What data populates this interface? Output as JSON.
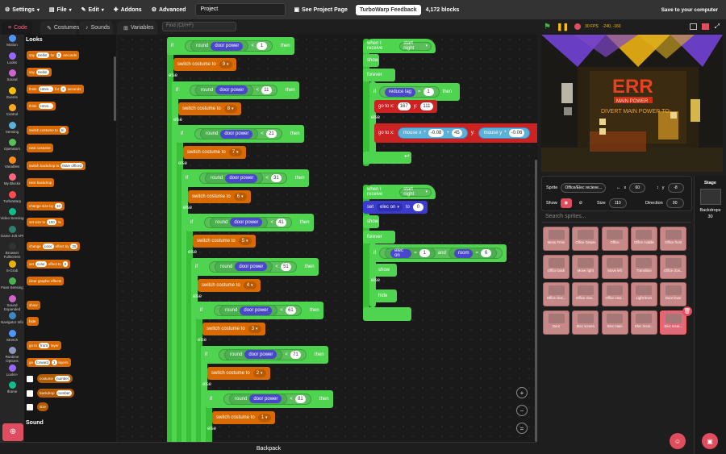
{
  "menu": {
    "settings": "Settings",
    "file": "File",
    "edit": "Edit",
    "addons": "Addons",
    "advanced": "Advanced",
    "project_title": "Project",
    "see_project_page": "See Project Page",
    "feedback": "TurboWarp Feedback",
    "block_count": "4,172 blocks",
    "save": "Save to your computer"
  },
  "tabs": {
    "code": "Code",
    "costumes": "Costumes",
    "sounds": "Sounds",
    "variables": "Variables"
  },
  "find_placeholder": "Find (Ctrl+F)",
  "categories": [
    {
      "label": "Motion",
      "color": "#4c97ff"
    },
    {
      "label": "Looks",
      "color": "#9966ff"
    },
    {
      "label": "Sound",
      "color": "#cf63cf"
    },
    {
      "label": "Events",
      "color": "#ffbf00"
    },
    {
      "label": "Control",
      "color": "#ffab19"
    },
    {
      "label": "Sensing",
      "color": "#5cb1d6"
    },
    {
      "label": "Operators",
      "color": "#59c059"
    },
    {
      "label": "Variables",
      "color": "#ff8c1a"
    },
    {
      "label": "My Blocks",
      "color": "#ff6680"
    },
    {
      "label": "TurboWarp",
      "color": "#ff4c4c"
    },
    {
      "label": "Video Sensing",
      "color": "#0fbd8c"
    },
    {
      "label": "Game Jolt API",
      "color": "#2f7f6f"
    },
    {
      "label": "Browser Fullscreen",
      "color": "#333333"
    },
    {
      "label": "S-Grab",
      "color": "#ecb00a"
    },
    {
      "label": "Fans Sensing",
      "color": "#4caf50"
    },
    {
      "label": "Sound Expanded",
      "color": "#cf63cf"
    },
    {
      "label": "Navigator Info",
      "color": "#3b88c3"
    },
    {
      "label": "Stretch",
      "color": "#4c97ff"
    },
    {
      "label": "Runtime Options",
      "color": "#8c9abd"
    },
    {
      "label": "Looks+",
      "color": "#9966ff"
    },
    {
      "label": "Iframe",
      "color": "#0fbd8c"
    }
  ],
  "palette": {
    "heading": "Looks",
    "sound_heading": "Sound",
    "blocks": [
      {
        "label": "say",
        "arg1": "Hello!",
        "mid": "for",
        "arg2": "2",
        "end": "seconds"
      },
      {
        "label": "say",
        "arg1": "Hello!"
      },
      {
        "label": "think",
        "arg1": "Hmm...",
        "mid": "for",
        "arg2": "2",
        "end": "seconds"
      },
      {
        "label": "think",
        "arg1": "Hmm..."
      },
      {
        "label": "switch costume to",
        "arg1": "tri"
      },
      {
        "label": "next costume"
      },
      {
        "label": "switch backdrop to",
        "arg1": "Main office2"
      },
      {
        "label": "next backdrop"
      },
      {
        "label": "change size by",
        "arg1": "10"
      },
      {
        "label": "set size to",
        "arg1": "100",
        "end": "%"
      },
      {
        "label": "change",
        "arg1": "color",
        "mid": "effect by",
        "arg2": "25"
      },
      {
        "label": "set",
        "arg1": "color",
        "mid": "effect to",
        "arg2": "0"
      },
      {
        "label": "clear graphic effects"
      },
      {
        "label": "show"
      },
      {
        "label": "hide"
      },
      {
        "label": "go to",
        "arg1": "front",
        "end": "layer"
      },
      {
        "label": "go",
        "arg1": "forward",
        "arg2": "1",
        "end": "layers"
      },
      {
        "label": "costume",
        "arg1": "number"
      },
      {
        "label": "backdrop",
        "arg1": "number"
      },
      {
        "label": "size"
      }
    ]
  },
  "script": {
    "kw_if": "if",
    "kw_then": "then",
    "kw_else": "else",
    "kw_round": "round",
    "var_door_power": "door power",
    "lt": "<",
    "switch_costume": "switch costume to",
    "rows": [
      {
        "threshold": "1",
        "costume": "9"
      },
      {
        "threshold": "11",
        "costume": "8"
      },
      {
        "threshold": "21",
        "costume": "7"
      },
      {
        "threshold": "31",
        "costume": "6"
      },
      {
        "threshold": "41",
        "costume": "5"
      },
      {
        "threshold": "51",
        "costume": "4"
      },
      {
        "threshold": "61",
        "costume": "3"
      },
      {
        "threshold": "71",
        "costume": "2"
      },
      {
        "threshold": "81",
        "costume": "1"
      }
    ]
  },
  "script2": {
    "hat": "when I receive",
    "hat_arg": "start night",
    "show": "show",
    "forever": "forever",
    "if": "if",
    "cond_var": "reduce lag",
    "eq": "=",
    "cond_val": "1",
    "then": "then",
    "goto": "go to x:",
    "x": "167",
    "ylab": "y:",
    "y": "111",
    "else": "else",
    "mouse_x": "mouse x",
    "times": "*",
    "mx_k": "-0.08",
    "plus": "+",
    "mx_off": "45",
    "mouse_y": "mouse y",
    "my_k": "-0.06"
  },
  "script3": {
    "hat": "when I receive",
    "hat_arg": "start night",
    "set": "set",
    "var": "elec on",
    "to": "to",
    "val": "0",
    "show": "show",
    "forever": "forever",
    "if": "if",
    "v1": "elec on",
    "eq": "=",
    "c1": "1",
    "and": "and",
    "v2": "room",
    "c2": "6",
    "then": "then",
    "show2": "show",
    "else": "else",
    "hide": "hide"
  },
  "stage": {
    "fps": "30 FPS",
    "coords": "-240, -160",
    "sign_text": "ERR",
    "sign_sub": "MAIN POWER",
    "sign_hint": "DIVERT MAIN POWER TO:"
  },
  "sprite_info": {
    "sprite_label": "Sprite",
    "sprite_name": "Office/Elec recieve...",
    "x_label": "x",
    "x": "60",
    "y_label": "y",
    "y": "-8",
    "show_label": "Show",
    "size_label": "Size",
    "size": "110",
    "direction_label": "Direction",
    "direction": "90"
  },
  "sprite_search_placeholder": "Search sprites...",
  "sprites": [
    "Menu Fmm",
    "Office Gewer",
    "Office",
    "Office middle",
    "Office front",
    "Office back",
    "Move right",
    "Move left",
    "Transition",
    "Office clos...",
    "Office clos...",
    "Office clos...",
    "Office clos...",
    "Light lever",
    "Door lever",
    "Door",
    "Elec screen",
    "Elec main",
    "Elec recei...",
    "Elec recei..."
  ],
  "stage_pane": {
    "title": "Stage",
    "backdrops_label": "Backdrops",
    "backdrops_count": "30"
  },
  "backpack": "Backpack"
}
